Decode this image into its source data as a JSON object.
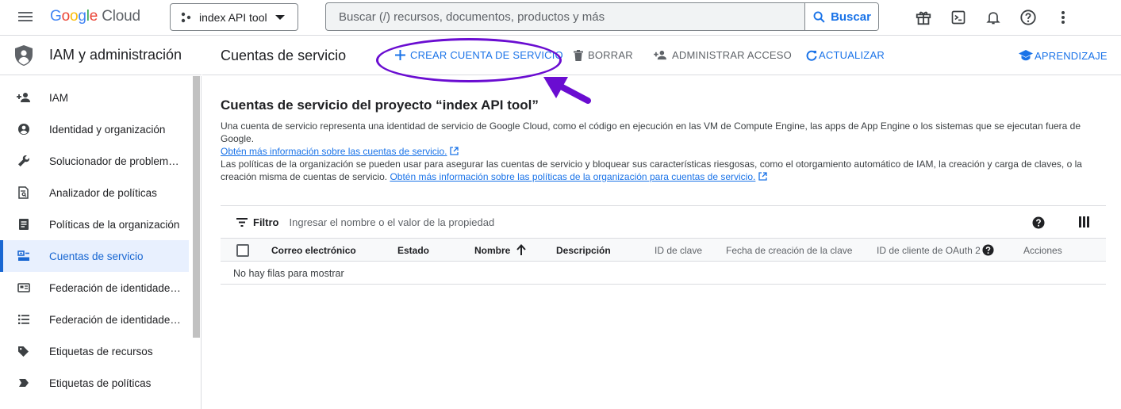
{
  "topbar": {
    "logo": {
      "part1": "G",
      "part2": "o",
      "part3": "o",
      "part4": "g",
      "part5": "l",
      "part6": "e",
      "part7": " Cloud"
    },
    "project": "index API tool",
    "search_placeholder": "Buscar (/) recursos, documentos, productos y más",
    "search_button": "Buscar",
    "icons": [
      "gift-icon",
      "cloud-shell-icon",
      "bell-icon",
      "help-icon",
      "more-vert-icon"
    ]
  },
  "nav": {
    "title": "IAM y administración",
    "items": [
      {
        "label": "IAM",
        "icon": "person-add-icon"
      },
      {
        "label": "Identidad y organización",
        "icon": "account-circle-icon"
      },
      {
        "label": "Solucionador de problem…",
        "icon": "wrench-icon"
      },
      {
        "label": "Analizador de políticas",
        "icon": "document-search-icon"
      },
      {
        "label": "Políticas de la organización",
        "icon": "list-document-icon"
      },
      {
        "label": "Cuentas de servicio",
        "icon": "service-account-icon",
        "active": true
      },
      {
        "label": "Federación de identidade…",
        "icon": "id-card-icon"
      },
      {
        "label": "Federación de identidade…",
        "icon": "list-icon"
      },
      {
        "label": "Etiquetas de recursos",
        "icon": "tag-icon"
      },
      {
        "label": "Etiquetas de políticas",
        "icon": "label-icon"
      }
    ]
  },
  "page": {
    "title": "Cuentas de servicio",
    "toolbar": {
      "create": "CREAR CUENTA DE SERVICIO",
      "delete": "BORRAR",
      "manage_access": "ADMINISTRAR ACCESO",
      "refresh": "ACTUALIZAR",
      "learn": "APRENDIZAJE"
    },
    "heading": "Cuentas de servicio del proyecto “index API tool”",
    "desc1": "Una cuenta de servicio representa una identidad de servicio de Google Cloud, como el código en ejecución en las VM de Compute Engine, las apps de App Engine o los sistemas que se ejecutan fuera de Google.",
    "link1": "Obtén más información sobre las cuentas de servicio.",
    "desc2": "Las políticas de la organización se pueden usar para asegurar las cuentas de servicio y bloquear sus características riesgosas, como el otorgamiento automático de IAM, la creación y carga de claves, o la creación misma de cuentas de servicio.",
    "link2": "Obtén más información sobre las políticas de la organización para cuentas de servicio.",
    "filter_label": "Filtro",
    "filter_placeholder": "Ingresar el nombre o el valor de la propiedad",
    "columns": {
      "email": "Correo electrónico",
      "status": "Estado",
      "name": "Nombre",
      "description": "Descripción",
      "key_id": "ID de clave",
      "key_created": "Fecha de creación de la clave",
      "oauth_client": "ID de cliente de OAuth 2",
      "actions": "Acciones"
    },
    "empty": "No hay filas para mostrar"
  },
  "colors": {
    "accent": "#1a73e8",
    "annotation": "#6a0dd1",
    "active_nav_bg": "#e8f0fe"
  }
}
